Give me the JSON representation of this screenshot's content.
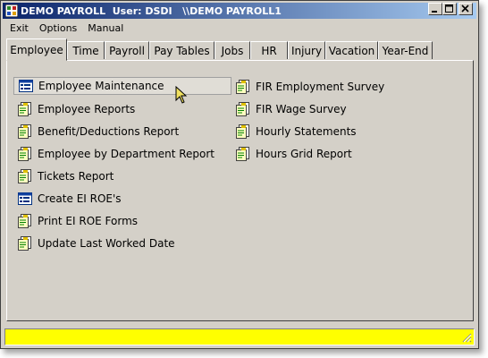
{
  "window": {
    "title": "DEMO PAYROLL  User: DSDI   \\\\DEMO PAYROLL1",
    "controls": {
      "minimize": "minimize-icon",
      "maximize": "maximize-icon",
      "close": "close-icon"
    }
  },
  "menu": {
    "items": [
      "Exit",
      "Options",
      "Manual"
    ]
  },
  "tabs": [
    "Employee",
    "Time",
    "Payroll",
    "Pay Tables",
    "Jobs",
    "HR",
    "Injury",
    "Vacation",
    "Year-End"
  ],
  "active_tab": "Employee",
  "left_items": [
    {
      "label": "Employee Maintenance",
      "icon": "form-icon"
    },
    {
      "label": "Employee Reports",
      "icon": "report-icon"
    },
    {
      "label": "Benefit/Deductions Report",
      "icon": "report-icon"
    },
    {
      "label": "Employee by Department Report",
      "icon": "report-icon"
    },
    {
      "label": "Tickets Report",
      "icon": "report-icon"
    },
    {
      "label": "Create EI ROE's",
      "icon": "form-icon"
    },
    {
      "label": "Print EI ROE Forms",
      "icon": "report-icon"
    },
    {
      "label": "Update Last Worked Date",
      "icon": "report-icon"
    }
  ],
  "right_items": [
    {
      "label": "FIR Employment Survey",
      "icon": "report-icon"
    },
    {
      "label": "FIR Wage Survey",
      "icon": "report-icon"
    },
    {
      "label": "Hourly Statements",
      "icon": "report-icon"
    },
    {
      "label": "Hours Grid Report",
      "icon": "report-icon"
    }
  ],
  "status": {
    "text": "",
    "color": "#ffff00"
  },
  "colors": {
    "titlebar_start": "#0a246a",
    "titlebar_end": "#a6caf0",
    "face": "#d4d0c8",
    "status": "#ffff00"
  }
}
